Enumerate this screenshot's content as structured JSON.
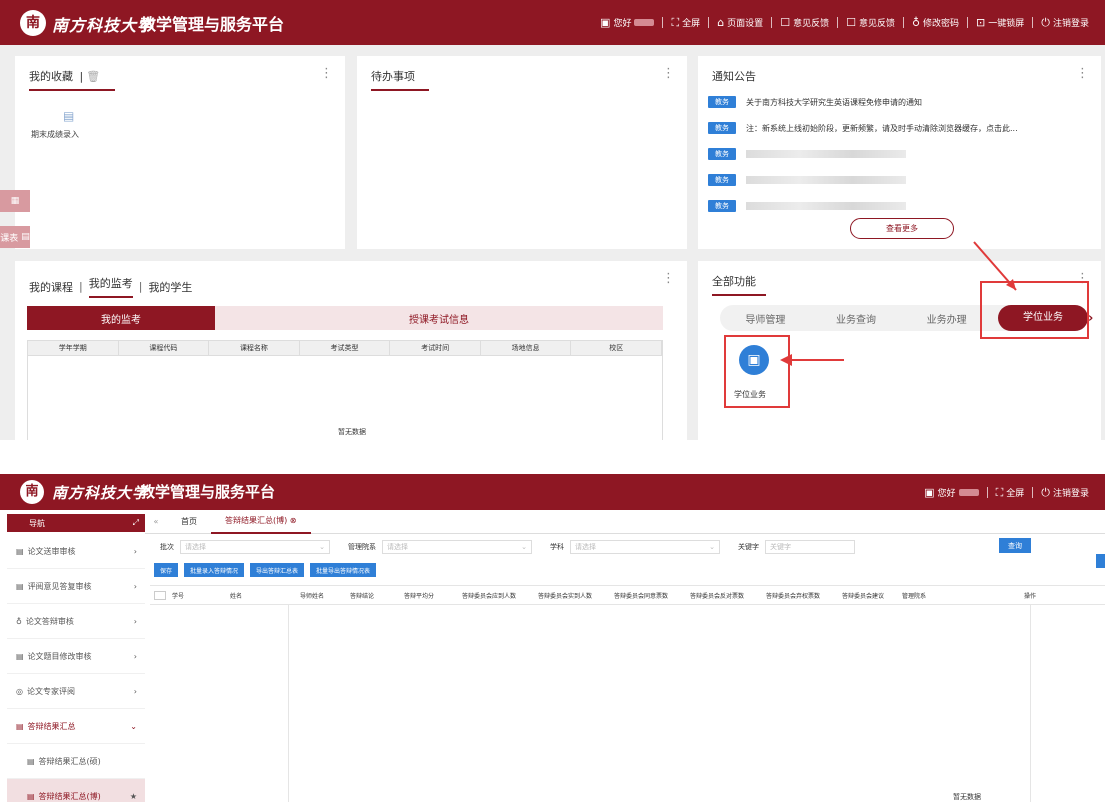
{
  "header": {
    "logo_glyph": "南",
    "university": "南方科技大学",
    "title": "教学管理与服务平台",
    "nav": [
      "您好",
      "全屏",
      "页面设置",
      "意见反馈",
      "意见反馈",
      "修改密码",
      "一键锁屏",
      "注销登录"
    ]
  },
  "favorites": {
    "title": "我的收藏",
    "separator": "|",
    "item": "期末成绩录入"
  },
  "todo": {
    "title": "待办事项"
  },
  "notices": {
    "title": "通知公告",
    "tag": "教务",
    "items": [
      "关于南方科技大学研究生英语课程免修申请的通知",
      "注：新系统上线初始阶段，更新频繁，请及时手动清除浏览器缓存，点击此..."
    ],
    "more": "查看更多"
  },
  "side_tab": {
    "label": "课表"
  },
  "courses": {
    "tabs": [
      "我的课程",
      "我的监考",
      "我的学生"
    ],
    "subtabs": [
      "我的监考",
      "授课考试信息"
    ],
    "columns": [
      "学年学期",
      "课程代码",
      "课程名称",
      "考试类型",
      "考试时间",
      "场地信息",
      "校区"
    ],
    "empty": "暂无数据"
  },
  "functions": {
    "title": "全部功能",
    "tabs": [
      "导师管理",
      "业务查询",
      "业务办理",
      "学位业务"
    ],
    "item": "学位业务"
  },
  "bottom": {
    "header_nav": [
      "您好",
      "全屏",
      "注销登录"
    ],
    "nav_title": "导航",
    "menu": [
      {
        "label": "论文送审审核"
      },
      {
        "label": "评阅意见答复审核"
      },
      {
        "label": "论文答辩审核"
      },
      {
        "label": "论文题目修改审核"
      },
      {
        "label": "论文专家评阅"
      },
      {
        "label": "答辩结果汇总"
      },
      {
        "label": "答辩结果汇总(硕)"
      },
      {
        "label": "答辩结果汇总(博)"
      }
    ],
    "tabs": [
      "首页",
      "答辩结果汇总(博)"
    ],
    "filters": [
      {
        "label": "批次",
        "placeholder": "请选择"
      },
      {
        "label": "管理院系",
        "placeholder": "请选择"
      },
      {
        "label": "学科",
        "placeholder": "请选择"
      },
      {
        "label": "关键字",
        "placeholder": "关键字"
      }
    ],
    "query": "查询",
    "actions": [
      "保存",
      "批量录入答辩情况",
      "导出答辩汇总表",
      "批量导出答辩情况表"
    ],
    "columns": [
      "学号",
      "姓名",
      "导师姓名",
      "答辩结论",
      "答辩平均分",
      "答辩委员会应到人数",
      "答辩委员会实到人数",
      "答辩委员会同意票数",
      "答辩委员会反对票数",
      "答辩委员会弃权票数",
      "答辩委员会建议",
      "管理院系",
      "操作"
    ],
    "empty": "暂无数据"
  }
}
